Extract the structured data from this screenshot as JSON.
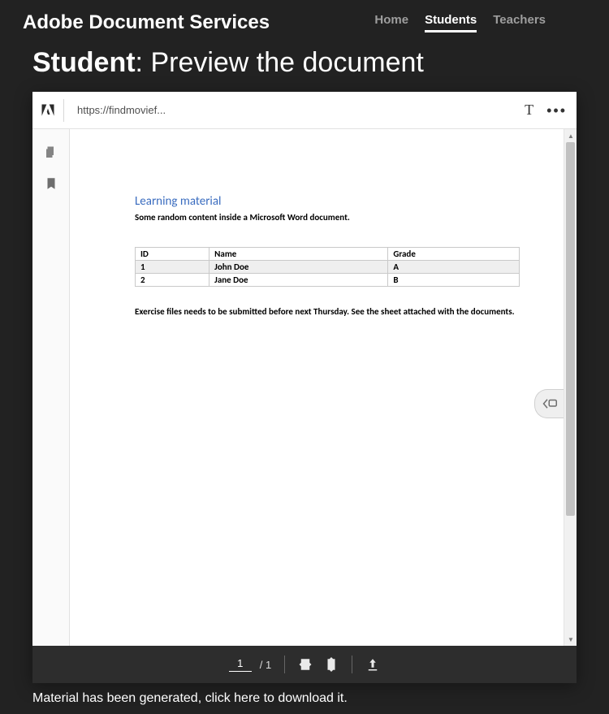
{
  "header": {
    "brand": "Adobe Document Services",
    "nav": [
      {
        "label": "Home",
        "active": false
      },
      {
        "label": "Students",
        "active": true
      },
      {
        "label": "Teachers",
        "active": false
      }
    ]
  },
  "page": {
    "title_bold": "Student",
    "title_rest": ": Preview the document"
  },
  "viewer": {
    "url": "https://findmovief...",
    "text_tool": "T",
    "more": "•••"
  },
  "document": {
    "heading": "Learning material",
    "intro": "Some random content inside a Microsoft Word document.",
    "table": {
      "headers": [
        "ID",
        "Name",
        "Grade"
      ],
      "rows": [
        [
          "1",
          "John Doe",
          "A"
        ],
        [
          "2",
          "Jane Doe",
          "B"
        ]
      ]
    },
    "footer_text": "Exercise files needs to be submitted before next Thursday. See the sheet attached with the documents."
  },
  "hud": {
    "page_current": "1",
    "page_total": "/ 1"
  },
  "download": {
    "message": "Material has been generated, click here to download it."
  },
  "comment_tab": "‹▣"
}
